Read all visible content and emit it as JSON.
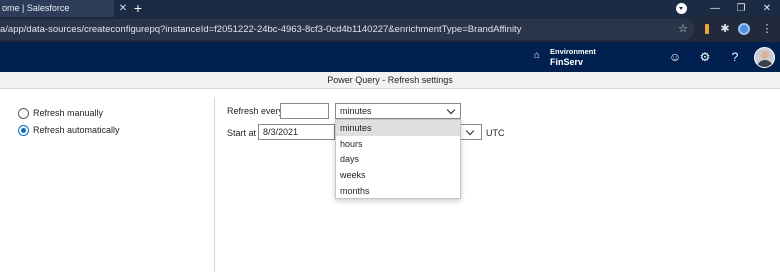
{
  "browser": {
    "tab_title": "ome | Salesforce",
    "tab_close": "✕",
    "new_tab": "+",
    "url": "a/app/data-sources/createconfigurepq?instanceId=f2051222-24bc-4963-8cf3-0cd4b1140227&enrichmentType=BrandAffinity",
    "window_controls": [
      "—",
      "❐",
      "✕"
    ]
  },
  "header": {
    "environment_label": "Environment",
    "environment_value": "FinServ"
  },
  "dialog": {
    "title": "Power Query - Refresh settings"
  },
  "refresh_mode": {
    "options": [
      {
        "label": "Refresh manually",
        "selected": false
      },
      {
        "label": "Refresh automatically",
        "selected": true
      }
    ]
  },
  "schedule": {
    "refresh_every_label": "Refresh every",
    "refresh_every_value": "",
    "unit_value": "minutes",
    "unit_options": [
      "minutes",
      "hours",
      "days",
      "weeks",
      "months"
    ],
    "start_at_label": "Start at",
    "start_date": "8/3/2021",
    "timezone": "UTC"
  },
  "icons": {
    "profile": "profile-icon",
    "star": "bookmark-star-icon",
    "extensions": [
      "orange-extension-icon",
      "puzzle-icon",
      "blue-extension-icon",
      "more-vertical-icon"
    ],
    "environment": "environment-icon",
    "header": [
      "smiley-icon",
      "gear-icon",
      "help-icon",
      "avatar"
    ]
  },
  "colors": {
    "app_header": "#002050",
    "accent": "#0f6cbd",
    "selected_option": "#e1dfdd"
  }
}
